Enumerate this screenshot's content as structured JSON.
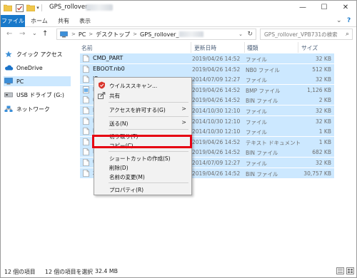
{
  "window": {
    "title": "GPS_rollover_",
    "minimize_glyph": "—",
    "maximize_glyph": "☐",
    "close_glyph": "✕"
  },
  "ribbon": {
    "tabs": [
      "ファイル",
      "ホーム",
      "共有",
      "表示"
    ],
    "expand_glyph": "⌄",
    "help_glyph": "?"
  },
  "address": {
    "back_glyph": "←",
    "forward_glyph": "→",
    "recent_glyph": "⌄",
    "up_glyph": "↑",
    "crumbs": [
      "PC",
      "デスクトップ",
      "GPS_rollover_"
    ],
    "chevron": ">",
    "search_placeholder": "GPS_rollover_VPB731の検索"
  },
  "navpane": {
    "items": [
      {
        "label": "クイック アクセス",
        "icon": "star-icon"
      },
      {
        "label": "OneDrive",
        "icon": "cloud-icon"
      },
      {
        "label": "PC",
        "icon": "pc-icon"
      },
      {
        "label": "USB ドライブ (G:)",
        "icon": "usb-drive-icon"
      },
      {
        "label": "ネットワーク",
        "icon": "network-icon"
      }
    ]
  },
  "columns": {
    "name": "名前",
    "date": "更新日時",
    "type": "種類",
    "size": "サイズ"
  },
  "files": [
    {
      "name": "CMD_PART",
      "date": "2019/04/26 14:52",
      "type": "ファイル",
      "size": "32 KB"
    },
    {
      "name": "EBOOT.nb0",
      "date": "2019/04/26 14:52",
      "type": "NB0 ファイル",
      "size": "512 KB"
    },
    {
      "name": "IP",
      "date": "2014/07/09 12:27",
      "type": "ファイル",
      "size": "32 KB"
    },
    {
      "name": "LO",
      "date": "2019/04/26 14:52",
      "type": "BMP ファイル",
      "size": "1,126 KB"
    },
    {
      "name": "m",
      "date": "2019/04/26 14:52",
      "type": "BIN ファイル",
      "size": "2 KB"
    },
    {
      "name": "N",
      "date": "2014/10/30 12:10",
      "type": "ファイル",
      "size": "32 KB"
    },
    {
      "name": "PA",
      "date": "2014/10/30 12:10",
      "type": "ファイル",
      "size": "32 KB"
    },
    {
      "name": "PA",
      "date": "2014/10/30 12:10",
      "type": "ファイル",
      "size": "1 KB"
    },
    {
      "name": "Re",
      "date": "2019/04/26 14:52",
      "type": "テキスト ドキュメント",
      "size": "1 KB"
    },
    {
      "name": "R",
      "date": "2019/04/26 14:52",
      "type": "BIN ファイル",
      "size": "682 KB"
    },
    {
      "name": "UI",
      "date": "2014/07/09 12:27",
      "type": "ファイル",
      "size": "32 KB"
    },
    {
      "name": "xi",
      "date": "2019/04/26 14:52",
      "type": "BIN ファイル",
      "size": "30,757 KB"
    }
  ],
  "context_menu": {
    "items": [
      {
        "label": "ウイルススキャン...",
        "icon": "antivirus-icon"
      },
      {
        "label": "共有",
        "icon": "share-icon"
      },
      {
        "label": "アクセスを許可する(G)",
        "submenu": true
      },
      {
        "label": "送る(N)",
        "submenu": true
      },
      {
        "label": "切り取り(T)"
      },
      {
        "label": "コピー(C)"
      },
      {
        "label": "ショートカットの作成(S)"
      },
      {
        "label": "削除(D)"
      },
      {
        "label": "名前の変更(M)"
      },
      {
        "label": "プロパティ(R)"
      }
    ],
    "submenu_glyph": ">",
    "highlighted": "コピー(C)"
  },
  "status": {
    "count": "12 個の項目",
    "selected": "12 個の項目を選択",
    "size": "32.4 MB"
  },
  "colors": {
    "accent": "#1979ca",
    "selection": "#cce8ff",
    "highlight_box": "#e60012",
    "folder": "#f0c64a"
  }
}
